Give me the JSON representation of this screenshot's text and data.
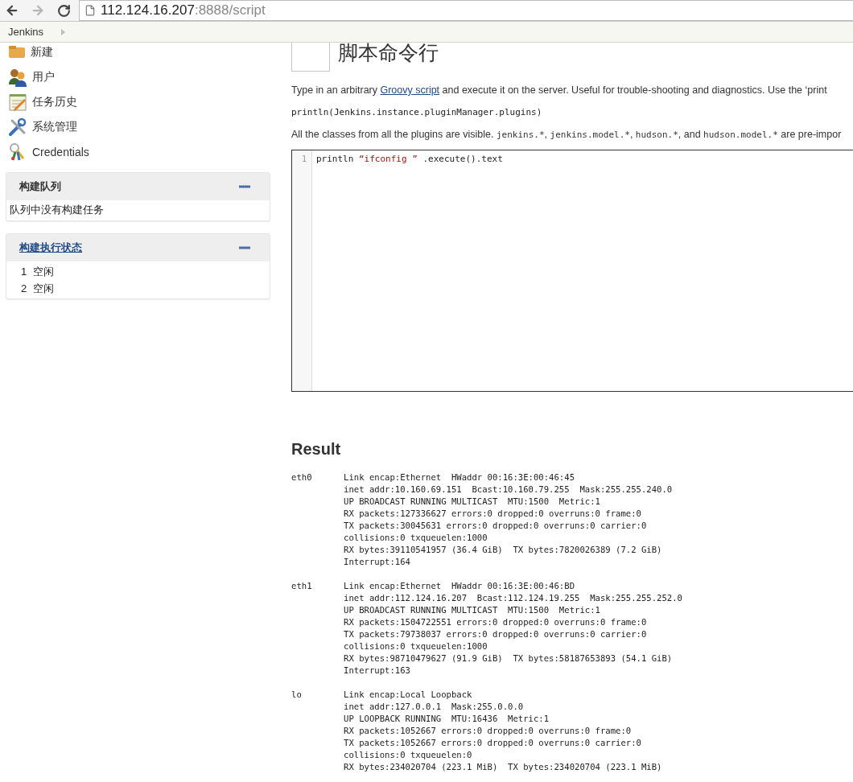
{
  "browser": {
    "url_host": "112.124.16.207",
    "url_path": ":8888/script"
  },
  "breadcrumb": [
    "Jenkins"
  ],
  "sidebar": {
    "items": [
      {
        "label": "新建",
        "kind": "new"
      },
      {
        "label": "用户",
        "kind": "people"
      },
      {
        "label": "任务历史",
        "kind": "history"
      },
      {
        "label": "系统管理",
        "kind": "manage"
      },
      {
        "label": "Credentials",
        "kind": "credentials"
      }
    ]
  },
  "build_queue": {
    "title": "构建队列",
    "expanded": true,
    "empty_text": "队列中没有构建任务"
  },
  "executors": {
    "title": "构建执行状态",
    "expanded": true,
    "items": [
      {
        "number": "1",
        "status": "空闲"
      },
      {
        "number": "2",
        "status": "空闲"
      }
    ]
  },
  "main": {
    "title": "脚本命令行",
    "intro": {
      "before": "Type in an arbitrary ",
      "link": "Groovy script",
      "after": " and execute it on the server. Useful for trouble-shooting and diagnostics. Use the ‘print"
    },
    "example": "println(Jenkins.instance.pluginManager.plugins)",
    "classes": [
      {
        "text": "All the classes from all the plugins are visible. ",
        "kind": "plain"
      },
      {
        "text": "jenkins.*",
        "kind": "code"
      },
      {
        "text": ", ",
        "kind": "plain"
      },
      {
        "text": "jenkins.model.*",
        "kind": "code"
      },
      {
        "text": ", ",
        "kind": "plain"
      },
      {
        "text": "hudson.*",
        "kind": "code"
      },
      {
        "text": ", and ",
        "kind": "plain"
      },
      {
        "text": "hudson.model.*",
        "kind": "code"
      },
      {
        "text": " are pre-impor",
        "kind": "plain"
      }
    ],
    "editor": {
      "lines": [
        {
          "number": "1",
          "tokens": [
            {
              "text": "println ",
              "kind": "plain"
            },
            {
              "text": "“ifconfig ”",
              "kind": "string"
            },
            {
              "text": " .execute().text",
              "kind": "plain"
            }
          ]
        }
      ]
    }
  },
  "result": {
    "heading": "Result",
    "interfaces": [
      {
        "name": "eth0",
        "lines": [
          "Link encap:Ethernet  HWaddr 00:16:3E:00:46:45",
          "inet addr:10.160.69.151  Bcast:10.160.79.255  Mask:255.255.240.0",
          "UP BROADCAST RUNNING MULTICAST  MTU:1500  Metric:1",
          "RX packets:127336627 errors:0 dropped:0 overruns:0 frame:0",
          "TX packets:30045631 errors:0 dropped:0 overruns:0 carrier:0",
          "collisions:0 txqueuelen:1000",
          "RX bytes:39110541957 (36.4 GiB)  TX bytes:7820026389 (7.2 GiB)",
          "Interrupt:164"
        ]
      },
      {
        "name": "eth1",
        "lines": [
          "Link encap:Ethernet  HWaddr 00:16:3E:00:46:BD",
          "inet addr:112.124.16.207  Bcast:112.124.19.255  Mask:255.255.252.0",
          "UP BROADCAST RUNNING MULTICAST  MTU:1500  Metric:1",
          "RX packets:1504722551 errors:0 dropped:0 overruns:0 frame:0",
          "TX packets:79738037 errors:0 dropped:0 overruns:0 carrier:0",
          "collisions:0 txqueuelen:1000",
          "RX bytes:98710479627 (91.9 GiB)  TX bytes:58187653893 (54.1 GiB)",
          "Interrupt:163"
        ]
      },
      {
        "name": "lo",
        "lines": [
          "Link encap:Local Loopback",
          "inet addr:127.0.0.1  Mask:255.0.0.0",
          "UP LOOPBACK RUNNING  MTU:16436  Metric:1",
          "RX packets:1052667 errors:0 dropped:0 overruns:0 frame:0",
          "TX packets:1052667 errors:0 dropped:0 overruns:0 carrier:0",
          "collisions:0 txqueuelen:0",
          "RX bytes:234020704 (223.1 MiB)  TX bytes:234020704 (223.1 MiB)"
        ]
      }
    ]
  }
}
